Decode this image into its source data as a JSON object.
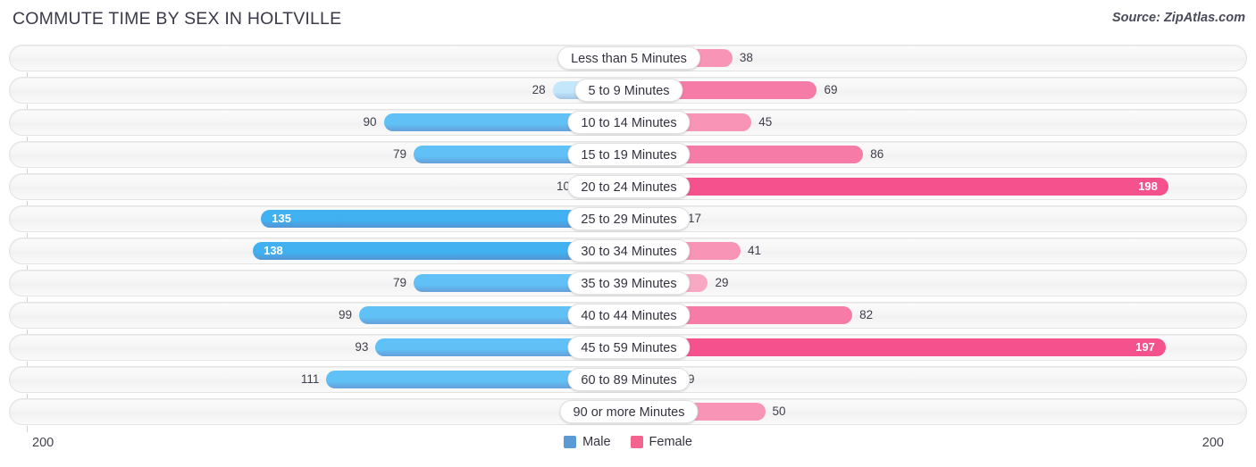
{
  "header": {
    "title": "COMMUTE TIME BY SEX IN HOLTVILLE",
    "source": "Source: ZipAtlas.com"
  },
  "axis": {
    "left_label": "200",
    "right_label": "200",
    "max": 200
  },
  "legend": {
    "items": [
      {
        "label": "Male",
        "color": "#5b9bd5"
      },
      {
        "label": "Female",
        "color": "#f4628f"
      }
    ]
  },
  "colors": {
    "male_strong": "#5b9bd5",
    "male_light": "#a8c8e8",
    "female_strong": "#f4518d",
    "female_mid": "#f77ba7",
    "female_light": "#f9a8c4",
    "track": "#f4f4f4",
    "axis": "#cfcfcf"
  },
  "chart_data": {
    "type": "bar",
    "title": "COMMUTE TIME BY SEX IN HOLTVILLE",
    "orientation": "horizontal-diverging",
    "xlabel": "",
    "ylabel": "",
    "xlim": [
      200,
      200
    ],
    "grid": false,
    "legend_position": "bottom-center",
    "categories": [
      "Less than 5 Minutes",
      "5 to 9 Minutes",
      "10 to 14 Minutes",
      "15 to 19 Minutes",
      "20 to 24 Minutes",
      "25 to 29 Minutes",
      "30 to 34 Minutes",
      "35 to 39 Minutes",
      "40 to 44 Minutes",
      "45 to 59 Minutes",
      "60 to 89 Minutes",
      "90 or more Minutes"
    ],
    "series": [
      {
        "name": "Male",
        "values": [
          0,
          28,
          90,
          79,
          10,
          135,
          138,
          79,
          99,
          93,
          111,
          0
        ]
      },
      {
        "name": "Female",
        "values": [
          38,
          69,
          45,
          86,
          198,
          17,
          41,
          29,
          82,
          197,
          9,
          50
        ]
      }
    ]
  },
  "rows": [
    {
      "label": "Less than 5 Minutes",
      "male": 0,
      "female": 38,
      "male_text": "0",
      "female_text": "38",
      "male_inside": false,
      "female_inside": false
    },
    {
      "label": "5 to 9 Minutes",
      "male": 28,
      "female": 69,
      "male_text": "28",
      "female_text": "69",
      "male_inside": false,
      "female_inside": false
    },
    {
      "label": "10 to 14 Minutes",
      "male": 90,
      "female": 45,
      "male_text": "90",
      "female_text": "45",
      "male_inside": false,
      "female_inside": false
    },
    {
      "label": "15 to 19 Minutes",
      "male": 79,
      "female": 86,
      "male_text": "79",
      "female_text": "86",
      "male_inside": false,
      "female_inside": false
    },
    {
      "label": "20 to 24 Minutes",
      "male": 10,
      "female": 198,
      "male_text": "10",
      "female_text": "198",
      "male_inside": false,
      "female_inside": true
    },
    {
      "label": "25 to 29 Minutes",
      "male": 135,
      "female": 17,
      "male_text": "135",
      "female_text": "17",
      "male_inside": true,
      "female_inside": false
    },
    {
      "label": "30 to 34 Minutes",
      "male": 138,
      "female": 41,
      "male_text": "138",
      "female_text": "41",
      "male_inside": true,
      "female_inside": false
    },
    {
      "label": "35 to 39 Minutes",
      "male": 79,
      "female": 29,
      "male_text": "79",
      "female_text": "29",
      "male_inside": false,
      "female_inside": false
    },
    {
      "label": "40 to 44 Minutes",
      "male": 99,
      "female": 82,
      "male_text": "99",
      "female_text": "82",
      "male_inside": false,
      "female_inside": false
    },
    {
      "label": "45 to 59 Minutes",
      "male": 93,
      "female": 197,
      "male_text": "93",
      "female_text": "197",
      "male_inside": false,
      "female_inside": true
    },
    {
      "label": "60 to 89 Minutes",
      "male": 111,
      "female": 9,
      "male_text": "111",
      "female_text": "9",
      "male_inside": false,
      "female_inside": false
    },
    {
      "label": "90 or more Minutes",
      "male": 0,
      "female": 50,
      "male_text": "0",
      "female_text": "50",
      "male_inside": false,
      "female_inside": false
    }
  ]
}
